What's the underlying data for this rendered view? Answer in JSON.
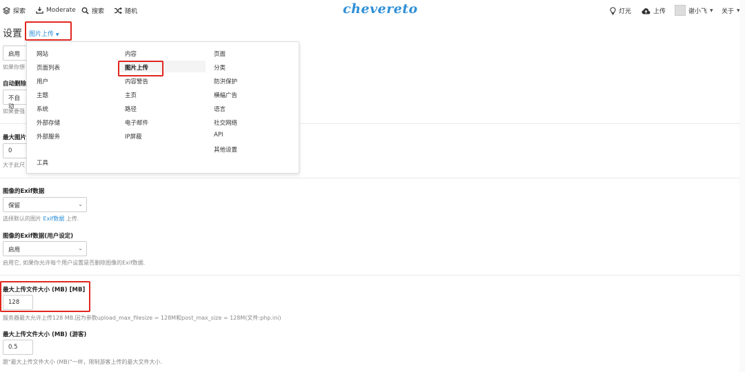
{
  "topbar": {
    "explore": "探索",
    "moderate": "Moderate",
    "search": "搜索",
    "random": "随机",
    "logo": "chevereto",
    "lights": "灯光",
    "upload": "上传",
    "user": "谢小飞",
    "about": "关于"
  },
  "header": {
    "title": "设置",
    "subsection": "图片上传"
  },
  "menu": {
    "col1": [
      "网站",
      "页面列表",
      "用户",
      "主题",
      "系统",
      "外部存储",
      "外部服务",
      "工具"
    ],
    "col2": [
      "内容",
      "图片上传",
      "内容警告",
      "主页",
      "路径",
      "电子邮件",
      "IP屏蔽"
    ],
    "col3": [
      "页面",
      "分类",
      "防洪保护",
      "横幅广告",
      "语言",
      "社交网络",
      "API",
      "其他设置"
    ],
    "active": "图片上传"
  },
  "behind": {
    "enable_value": "启用",
    "hint1": "如果你想",
    "auto_delete_label": "自动删除",
    "auto_delete_value": "不自动",
    "hint2": "如果要强",
    "max_image_label": "最大图片",
    "max_image_value": "0",
    "hint3": "大于此尺"
  },
  "exif": {
    "label": "图像的Exif数据",
    "value": "保留",
    "hint_pre": "选择默认的图片",
    "hint_link": "Exif数据",
    "hint_post": "上传."
  },
  "exif_user": {
    "label": "图像的Exif数据(用户设定)",
    "value": "启用",
    "hint": "启用它, 如果你允许每个用户设置是否删除图像的Exif数据."
  },
  "max_upload": {
    "label": "最大上传文件大小 (MB) [MB]",
    "value": "128",
    "hint": "服务器最大允许上传128 MB.因为参数upload_max_filesize = 128M和post_max_size = 128M(文件:php.ini)"
  },
  "max_upload_guest": {
    "label": "最大上传文件大小 (MB) (游客)",
    "value": "0.5",
    "hint": "跟\"最大上传文件大小 (MB)\"一样，限制游客上传的最大文件大小."
  },
  "colors": {
    "accent": "#2a8ed6",
    "highlight_box": "#e0261d",
    "logo": "#2f8fd8"
  }
}
